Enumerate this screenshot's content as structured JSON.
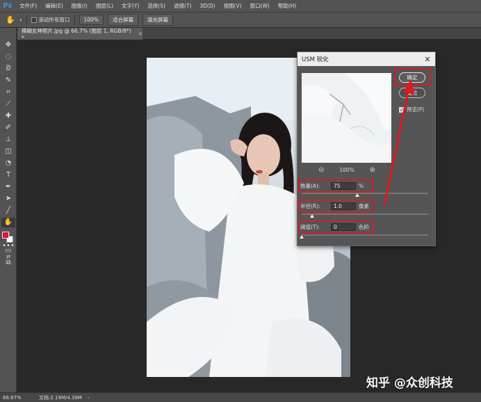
{
  "app": {
    "logo": "Ps"
  },
  "menu": [
    "文件(F)",
    "编辑(E)",
    "图像(I)",
    "图层(L)",
    "文字(Y)",
    "选择(S)",
    "滤镜(T)",
    "3D(D)",
    "视图(V)",
    "窗口(W)",
    "帮助(H)"
  ],
  "options_bar": {
    "scroll_all_windows": "滚动所有窗口",
    "zoom": "100%",
    "fit_screen": "适合屏幕",
    "fill_screen": "填充屏幕"
  },
  "document_tab": {
    "title": "模糊女神照片.jpg @ 66.7% (图层 1, RGB/8*) *",
    "close": "×"
  },
  "status_bar": {
    "zoom": "66.67%",
    "doc_info": "文档:2.19M/4.39M",
    "arrow": "›"
  },
  "dialog": {
    "title": "USM 锐化",
    "close": "✕",
    "ok_label": "确定",
    "reset_label": "复位",
    "preview_label": "预览(P)",
    "preview_zoom": "100%",
    "amount": {
      "label": "数量(A):",
      "value": "75",
      "unit": "%",
      "level": 0.44
    },
    "radius": {
      "label": "半径(R):",
      "value": "1.0",
      "unit": "像素",
      "level": 0.08
    },
    "threshold": {
      "label": "阈值(T):",
      "value": "0",
      "unit": "色阶",
      "level": 0.0
    }
  },
  "colors": {
    "foreground": "#e0133e",
    "background": "#ffffff",
    "highlight": "#d01f24"
  },
  "watermark": "知乎 @众创科技"
}
